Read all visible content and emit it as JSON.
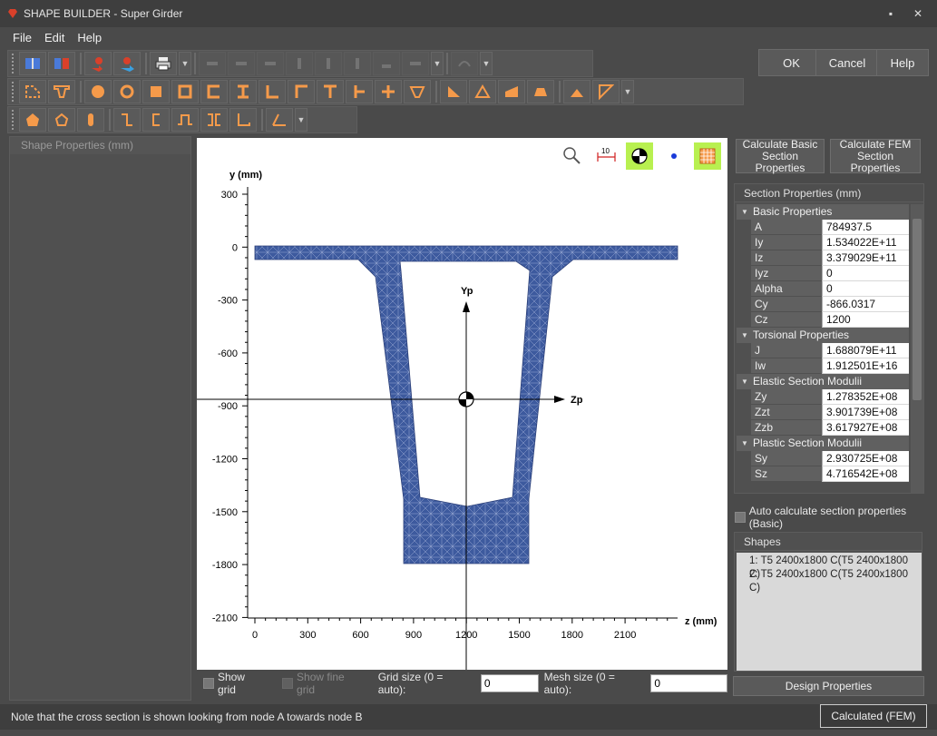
{
  "window": {
    "title": "SHAPE BUILDER - Super Girder",
    "minimize": "▪",
    "close": "✕"
  },
  "menu": [
    "File",
    "Edit",
    "Help"
  ],
  "dialog_buttons": {
    "ok": "OK",
    "cancel": "Cancel",
    "help": "Help"
  },
  "left_panel": {
    "title": "Shape Properties (mm)"
  },
  "canvas": {
    "y_axis_label": "y (mm)",
    "z_axis_label": "z (mm)",
    "principal_y": "Yp",
    "principal_z": "Zp",
    "scale_label": "10",
    "y_ticks": [
      "300",
      "0",
      "-300",
      "-600",
      "-900",
      "-1200",
      "-1500",
      "-1800",
      "-2100"
    ],
    "z_ticks": [
      "0",
      "300",
      "600",
      "900",
      "1200",
      "1500",
      "1800",
      "2100"
    ],
    "section_fill": "#3d5a9e",
    "highlight": "#b8f050"
  },
  "options": {
    "show_grid": "Show grid",
    "show_fine_grid": "Show fine grid",
    "grid_size_label": "Grid size (0 = auto):",
    "grid_size_value": "0",
    "mesh_size_label": "Mesh size (0 = auto):",
    "mesh_size_value": "0"
  },
  "calc": {
    "basic": "Calculate Basic\nSection Properties",
    "fem": "Calculate FEM\nSection Properties"
  },
  "section_properties": {
    "title": "Section Properties (mm)",
    "categories": [
      {
        "name": "Basic Properties",
        "rows": [
          [
            "A",
            "784937.5"
          ],
          [
            "Iy",
            "1.534022E+11"
          ],
          [
            "Iz",
            "3.379029E+11"
          ],
          [
            "Iyz",
            "0"
          ],
          [
            "Alpha",
            "0"
          ],
          [
            "Cy",
            "-866.0317"
          ],
          [
            "Cz",
            "1200"
          ]
        ]
      },
      {
        "name": "Torsional Properties",
        "rows": [
          [
            "J",
            "1.688079E+11"
          ],
          [
            "Iw",
            "1.912501E+16"
          ]
        ]
      },
      {
        "name": "Elastic Section Modulii",
        "rows": [
          [
            "Zy",
            "1.278352E+08"
          ],
          [
            "Zzt",
            "3.901739E+08"
          ],
          [
            "Zzb",
            "3.617927E+08"
          ]
        ]
      },
      {
        "name": "Plastic Section Modulii",
        "rows": [
          [
            "Sy",
            "2.930725E+08"
          ],
          [
            "Sz",
            "4.716542E+08"
          ]
        ]
      }
    ]
  },
  "auto_calc": "Auto calculate section properties (Basic)",
  "shapes": {
    "title": "Shapes",
    "items": [
      "1: T5 2400x1800 C(T5 2400x1800 C)",
      "2: T5 2400x1800 C(T5 2400x1800 C)"
    ]
  },
  "design_properties": "Design Properties",
  "status": {
    "note": "Note that the cross section is shown looking from node A towards node B",
    "badge": "Calculated (FEM)"
  }
}
